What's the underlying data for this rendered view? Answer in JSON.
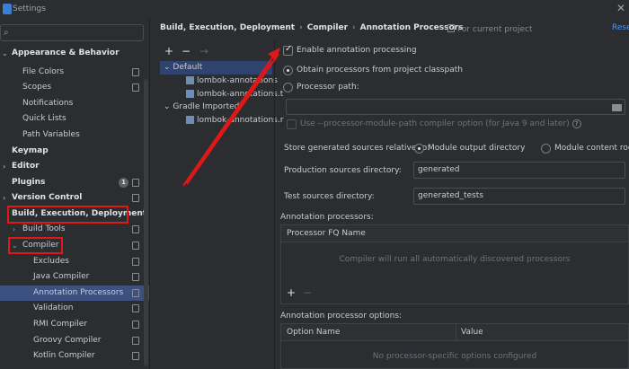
{
  "window": {
    "title": "Settings"
  },
  "search": {
    "placeholder": ""
  },
  "sidebar": {
    "items": [
      {
        "label": "Appearance & Behavior",
        "bold": true
      },
      {
        "label": "File Colors"
      },
      {
        "label": "Scopes"
      },
      {
        "label": "Notifications"
      },
      {
        "label": "Quick Lists"
      },
      {
        "label": "Path Variables"
      },
      {
        "label": "Keymap",
        "bold": true
      },
      {
        "label": "Editor",
        "bold": true
      },
      {
        "label": "Plugins",
        "bold": true,
        "badge": "1"
      },
      {
        "label": "Version Control",
        "bold": true
      },
      {
        "label": "Build, Execution, Deployment",
        "bold": true
      },
      {
        "label": "Build Tools"
      },
      {
        "label": "Compiler"
      },
      {
        "label": "Excludes"
      },
      {
        "label": "Java Compiler"
      },
      {
        "label": "Annotation Processors",
        "selected": true
      },
      {
        "label": "Validation"
      },
      {
        "label": "RMI Compiler"
      },
      {
        "label": "Groovy Compiler"
      },
      {
        "label": "Kotlin Compiler"
      }
    ]
  },
  "breadcrumb": {
    "parts": [
      "Build, Execution, Deployment",
      "Compiler",
      "Annotation Processors"
    ],
    "separator": "›",
    "for_project": "For current project",
    "reset": "Rese"
  },
  "profiles": {
    "add": "+",
    "remove": "−",
    "move": "→",
    "items": [
      {
        "label": "Default",
        "level": 0
      },
      {
        "label": "lombok-annotations",
        "level": 1
      },
      {
        "label": "lombok-annotations.t",
        "level": 1
      },
      {
        "label": "Gradle Imported",
        "level": 0
      },
      {
        "label": "lombok-annotations.r",
        "level": 1
      }
    ]
  },
  "settings": {
    "enable_annotation": {
      "label": "Enable annotation processing",
      "checked": true
    },
    "obtain_classpath": {
      "label": "Obtain processors from project classpath",
      "selected": true
    },
    "processor_path": {
      "label": "Processor path:",
      "value": ""
    },
    "module_path_option": {
      "label": "Use --processor-module-path compiler option (for Java 9 and later)"
    },
    "store_generated": {
      "label": "Store generated sources relative to:",
      "options": [
        "Module output directory",
        "Module content root"
      ],
      "selected": "Module output directory"
    },
    "production_dir": {
      "label": "Production sources directory:",
      "value": "generated"
    },
    "test_dir": {
      "label": "Test sources directory:",
      "value": "generated_tests"
    }
  },
  "processors_table": {
    "title": "Annotation processors:",
    "header": "Processor FQ Name",
    "empty": "Compiler will run all automatically discovered processors",
    "add": "+",
    "remove": "−"
  },
  "options_table": {
    "title": "Annotation processor options:",
    "headers": [
      "Option Name",
      "Value"
    ],
    "empty": "No processor-specific options configured"
  },
  "colors": {
    "background": "#2b2d30",
    "selection": "#3d5180",
    "accent": "#5394ec",
    "annotation_red": "#e01818"
  }
}
